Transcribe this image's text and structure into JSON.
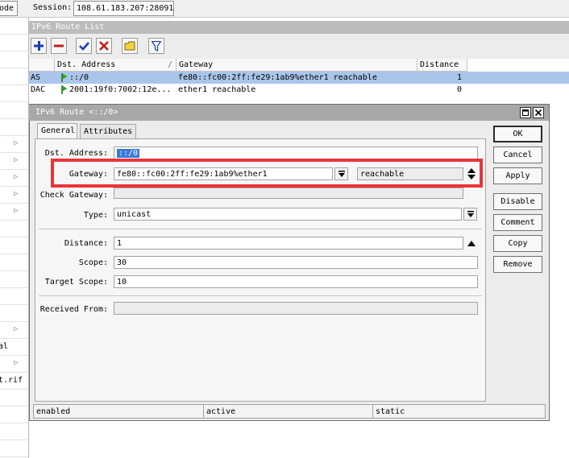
{
  "topbar": {
    "mode_button": "ode",
    "session_label": "Session:",
    "session_value": "108.61.183.207:28091"
  },
  "left_menu": {
    "texts": [
      "al",
      "t.rif"
    ]
  },
  "route_list": {
    "title": "IPv6 Route List",
    "columns": [
      "Dst. Address",
      "Gateway",
      "Distance"
    ],
    "sort_indicator": "/",
    "rows": [
      {
        "flags": "AS",
        "dst": "::/0",
        "gateway": "fe80::fc00:2ff:fe29:1ab9%ether1 reachable",
        "distance": "1"
      },
      {
        "flags": "DAC",
        "dst": "2001:19f0:7002:12e...",
        "gateway": "ether1 reachable",
        "distance": "0"
      }
    ]
  },
  "toolbar": {
    "icons": [
      "add-icon",
      "remove-icon",
      "enable-check-icon",
      "disable-x-icon",
      "comment-icon",
      "filter-icon"
    ]
  },
  "dialog": {
    "title": "IPv6 Route <::/0>",
    "tabs": [
      "General",
      "Attributes"
    ],
    "fields": {
      "dst_address": {
        "label": "Dst. Address:",
        "value": "::/0"
      },
      "gateway": {
        "label": "Gateway:",
        "value": "fe80::fc00:2ff:fe29:1ab9%ether1",
        "state": "reachable"
      },
      "check_gateway": {
        "label": "Check Gateway:",
        "value": ""
      },
      "type": {
        "label": "Type:",
        "value": "unicast"
      },
      "distance": {
        "label": "Distance:",
        "value": "1"
      },
      "scope": {
        "label": "Scope:",
        "value": "30"
      },
      "target_scope": {
        "label": "Target Scope:",
        "value": "10"
      },
      "received_from": {
        "label": "Received From:",
        "value": ""
      }
    },
    "buttons": {
      "ok": "OK",
      "cancel": "Cancel",
      "apply": "Apply",
      "disable": "Disable",
      "comment": "Comment",
      "copy": "Copy",
      "remove": "Remove"
    },
    "status": {
      "s1": "enabled",
      "s2": "active",
      "s3": "static"
    }
  },
  "colors": {
    "selected_row": "#a9c6ea",
    "highlight_box": "#e8353a",
    "title_bar": "#a8a8a8"
  }
}
